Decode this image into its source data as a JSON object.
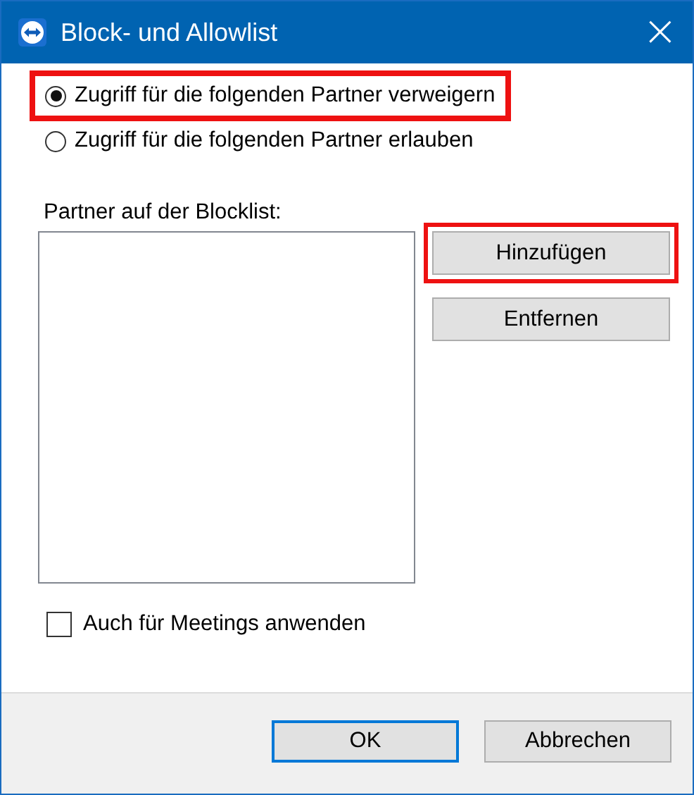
{
  "window": {
    "title": "Block- und Allowlist",
    "close": "×"
  },
  "options": [
    {
      "label": "Zugriff für die folgenden Partner verweigern",
      "selected": true,
      "highlighted": true
    },
    {
      "label": "Zugriff für die folgenden Partner erlauben",
      "selected": false,
      "highlighted": false
    }
  ],
  "list": {
    "label": "Partner auf der Blocklist:"
  },
  "list_buttons": [
    {
      "label": "Hinzufügen",
      "highlighted": true
    },
    {
      "label": "Entfernen",
      "highlighted": false
    }
  ],
  "meetings": {
    "label": "Auch für Meetings anwenden",
    "checked": false
  },
  "buttons": [
    {
      "label": "OK",
      "default": true
    },
    {
      "label": "Abbrechen",
      "default": false
    }
  ]
}
